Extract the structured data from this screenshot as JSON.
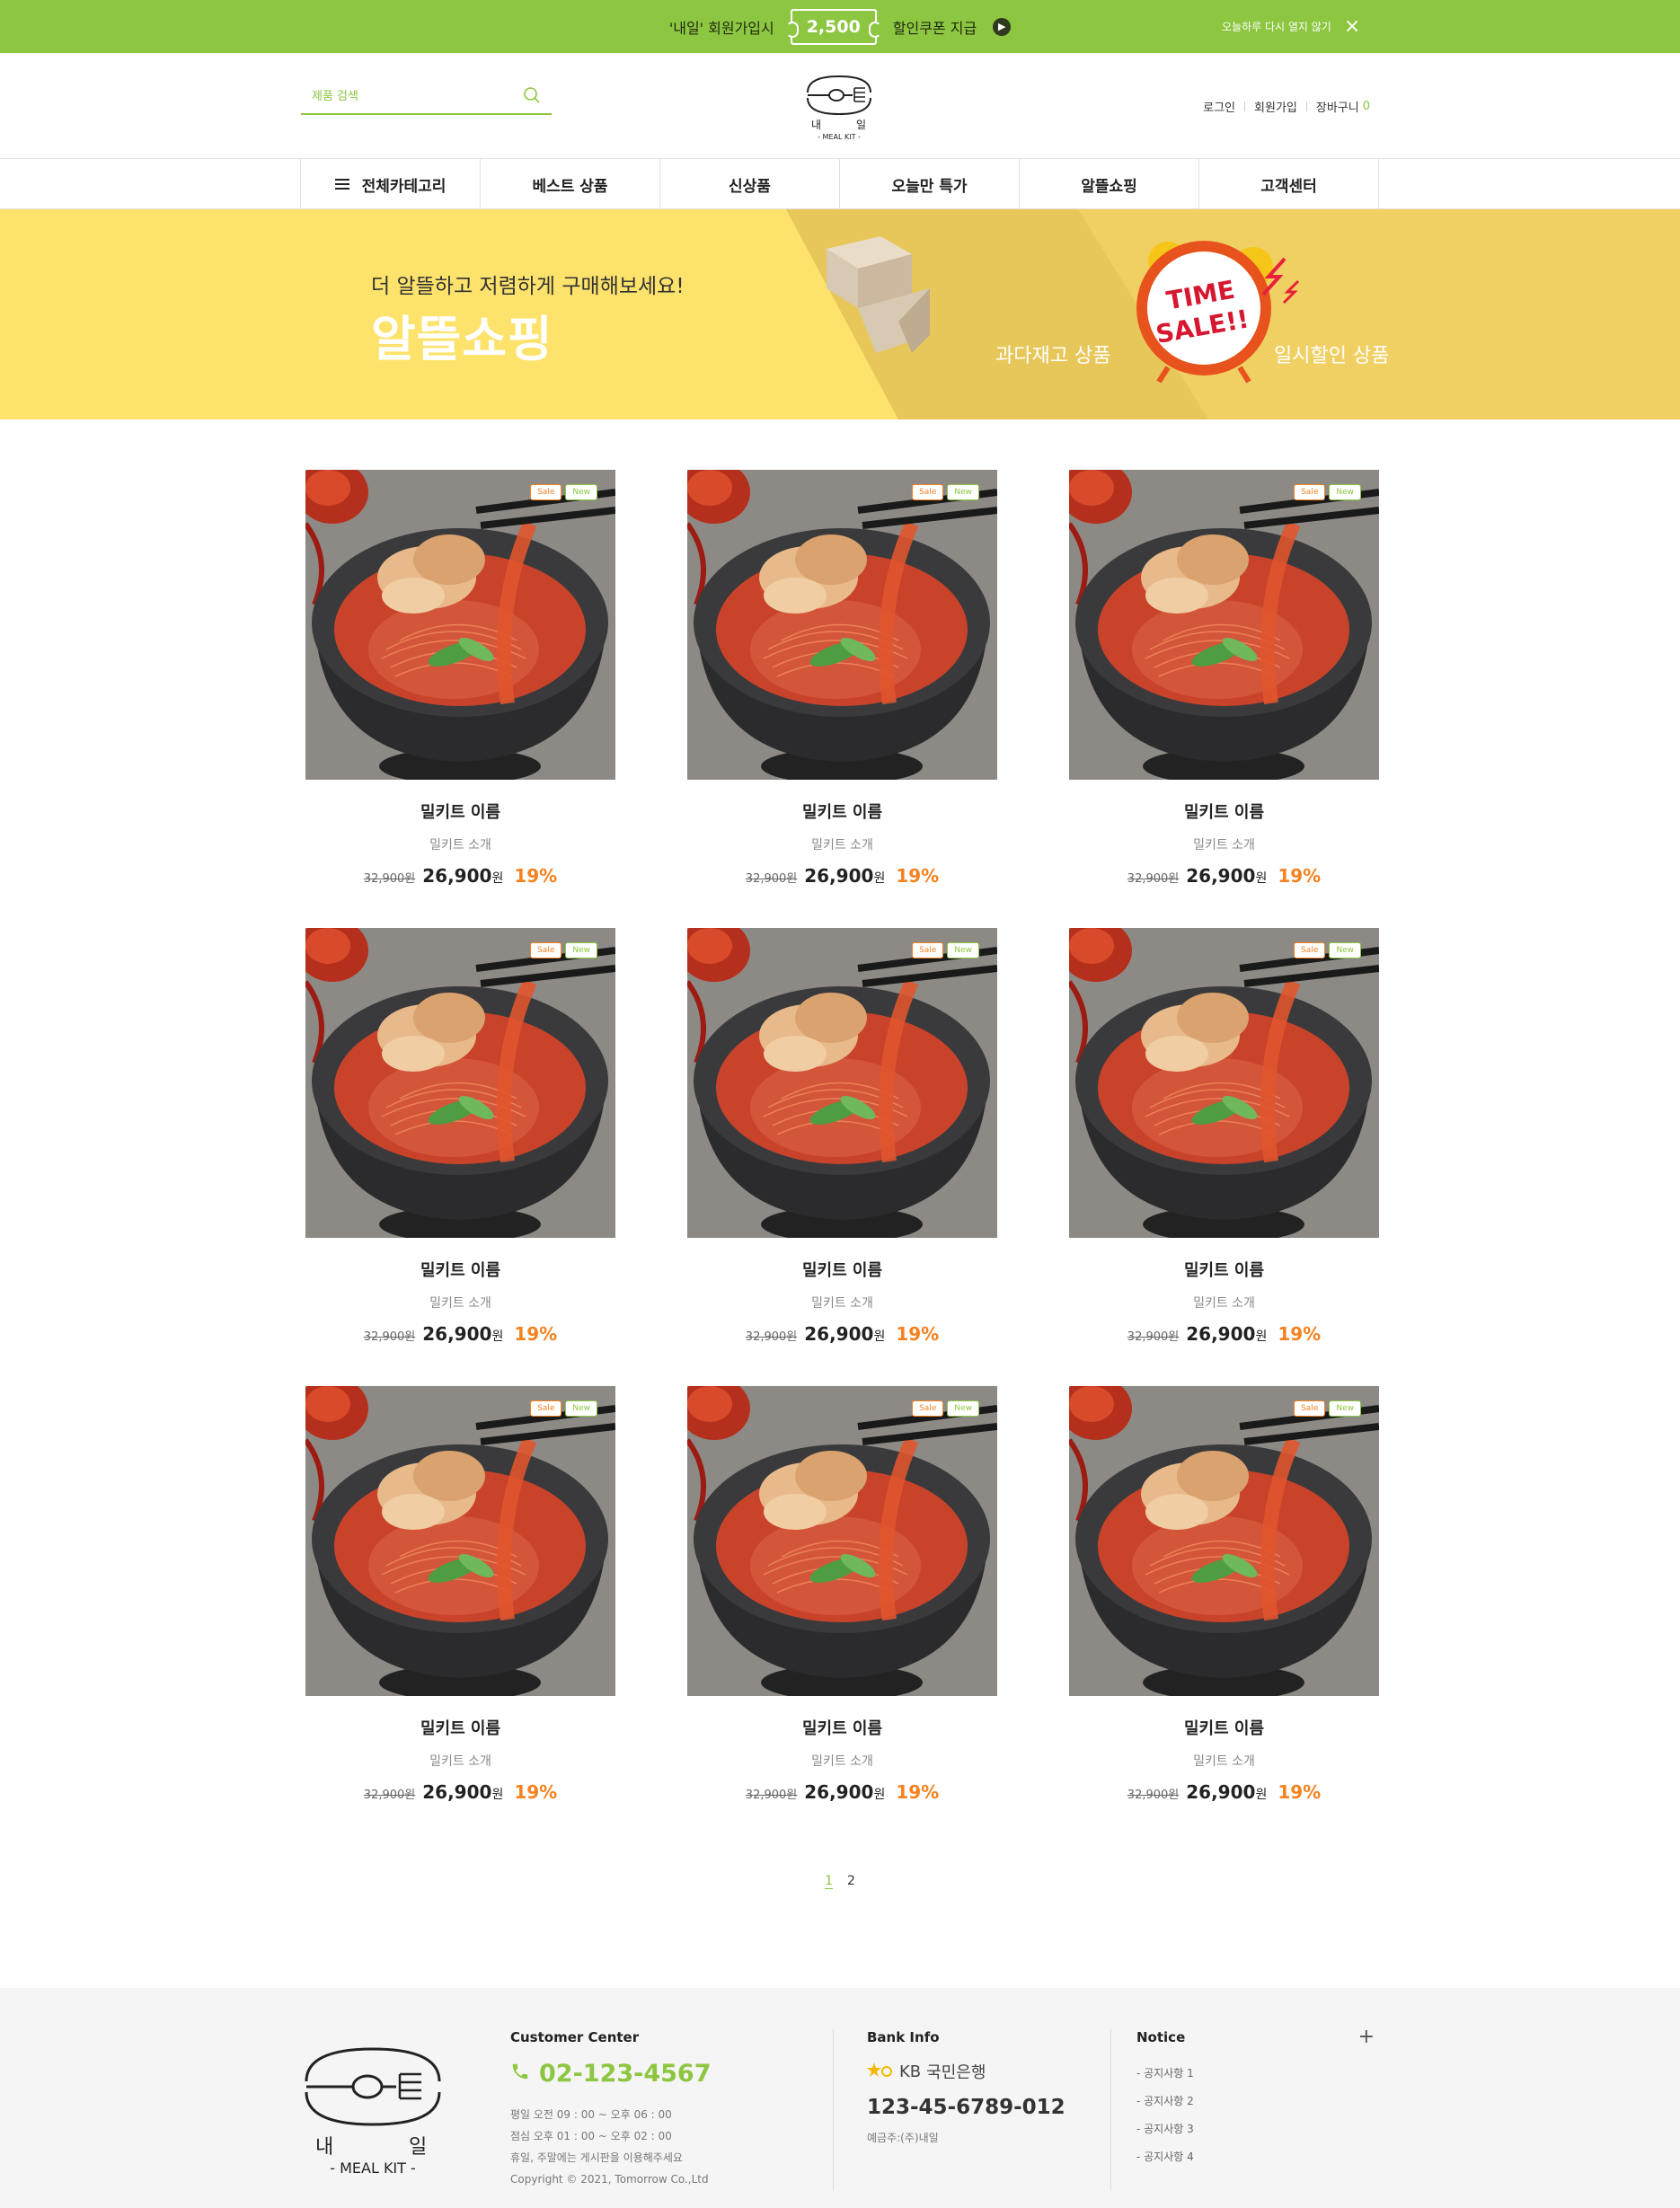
{
  "topbar": {
    "promo_prefix": "'내일' 회원가입시",
    "coupon_amount": "2,500",
    "promo_suffix": "할인쿠폰 지급",
    "dismiss_label": "오늘하루 다시 열지 않기"
  },
  "header": {
    "search_placeholder": "제품 검색",
    "logo_text_left": "내",
    "logo_text_right": "일",
    "logo_sub": "- MEAL KIT -",
    "login": "로그인",
    "signup": "회원가입",
    "cart": "장바구니",
    "cart_count": "0"
  },
  "nav": {
    "items": [
      "전체카테고리",
      "베스트 상품",
      "신상품",
      "오늘만 특가",
      "알뜰쇼핑",
      "고객센터"
    ]
  },
  "hero": {
    "subtitle": "더 알뜰하고 저렴하게 구매해보세요!",
    "title": "알뜰쇼핑",
    "category_1": "과다재고 상품",
    "category_2": "일시할인 상품",
    "time_sale_1": "TIME",
    "time_sale_2": "SALE!!"
  },
  "products": [
    {
      "name": "밀키트 이름",
      "desc": "밀키트 소개",
      "original_price": "32,900원",
      "price": "26,900",
      "unit": "원",
      "discount": "19%",
      "badge_sale": "Sale",
      "badge_new": "New"
    },
    {
      "name": "밀키트 이름",
      "desc": "밀키트 소개",
      "original_price": "32,900원",
      "price": "26,900",
      "unit": "원",
      "discount": "19%",
      "badge_sale": "Sale",
      "badge_new": "New"
    },
    {
      "name": "밀키트 이름",
      "desc": "밀키트 소개",
      "original_price": "32,900원",
      "price": "26,900",
      "unit": "원",
      "discount": "19%",
      "badge_sale": "Sale",
      "badge_new": "New"
    },
    {
      "name": "밀키트 이름",
      "desc": "밀키트 소개",
      "original_price": "32,900원",
      "price": "26,900",
      "unit": "원",
      "discount": "19%",
      "badge_sale": "Sale",
      "badge_new": "New"
    },
    {
      "name": "밀키트 이름",
      "desc": "밀키트 소개",
      "original_price": "32,900원",
      "price": "26,900",
      "unit": "원",
      "discount": "19%",
      "badge_sale": "Sale",
      "badge_new": "New"
    },
    {
      "name": "밀키트 이름",
      "desc": "밀키트 소개",
      "original_price": "32,900원",
      "price": "26,900",
      "unit": "원",
      "discount": "19%",
      "badge_sale": "Sale",
      "badge_new": "New"
    },
    {
      "name": "밀키트 이름",
      "desc": "밀키트 소개",
      "original_price": "32,900원",
      "price": "26,900",
      "unit": "원",
      "discount": "19%",
      "badge_sale": "Sale",
      "badge_new": "New"
    },
    {
      "name": "밀키트 이름",
      "desc": "밀키트 소개",
      "original_price": "32,900원",
      "price": "26,900",
      "unit": "원",
      "discount": "19%",
      "badge_sale": "Sale",
      "badge_new": "New"
    },
    {
      "name": "밀키트 이름",
      "desc": "밀키트 소개",
      "original_price": "32,900원",
      "price": "26,900",
      "unit": "원",
      "discount": "19%",
      "badge_sale": "Sale",
      "badge_new": "New"
    }
  ],
  "pagination": {
    "pages": [
      "1",
      "2"
    ],
    "current": "1"
  },
  "footer": {
    "cs_title": "Customer Center",
    "cs_phone": "02-123-4567",
    "cs_hours": [
      "평일 오전 09 : 00 ~ 오후 06 : 00",
      "점심 오후 01 : 00 ~ 오후 02 : 00",
      "휴일, 주말에는 게시판을 이용해주세요"
    ],
    "copyright": "Copyright © 2021, Tomorrow Co.,Ltd",
    "bank_title": "Bank Info",
    "bank_name": "국민은행",
    "bank_logo": "KB",
    "bank_account": "123-45-6789-012",
    "bank_holder": "예금주:(주)내일",
    "notice_title": "Notice",
    "notices": [
      "- 공지사항 1",
      "- 공지사항 2",
      "- 공지사항 3",
      "- 공지사항 4"
    ]
  },
  "colors": {
    "brand_green": "#8dc641",
    "accent_orange": "#f58220",
    "hero_yellow": "#fde36c"
  }
}
